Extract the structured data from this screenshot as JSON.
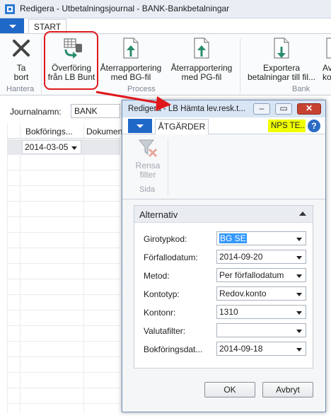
{
  "main": {
    "title": "Redigera - Utbetalningsjournal - BANK-Bankbetalningar",
    "tab": "START",
    "ribbon": {
      "ta_bort": "Ta\nbort",
      "overforing": "Överföring\nfrån LB Bunt",
      "ater_bg": "Återrapportering\nmed BG-fil",
      "ater_pg": "Återrapportering\nmed PG-fil",
      "exportera": "Exportera\nbetalningar till fil...",
      "partial_right": "Av\nko",
      "groups": {
        "hantera": "Hantera",
        "process": "Process",
        "bank": "Bank"
      }
    },
    "journal": {
      "label": "Journalnamn:",
      "value": "BANK"
    },
    "grid": {
      "col1": "Bokförings...",
      "col2": "Dokumen",
      "date_value": "2014-03-05"
    }
  },
  "dialog": {
    "title": "Redigera - LB Hämta lev.resk.t...",
    "tab": "ÅTGÄRDER",
    "badge": "NPS TE...",
    "help": "?",
    "rensa": "Rensa\nfilter",
    "sida": "Sida",
    "panel_title": "Alternativ",
    "fields": [
      {
        "label": "Girotypkod:",
        "value": "BG SE"
      },
      {
        "label": "Förfallodatum:",
        "value": "2014-09-20"
      },
      {
        "label": "Metod:",
        "value": "Per förfallodatum"
      },
      {
        "label": "Kontotyp:",
        "value": "Redov.konto"
      },
      {
        "label": "Kontonr:",
        "value": "1310"
      },
      {
        "label": "Valutafilter:",
        "value": ""
      },
      {
        "label": "Bokföringsdat...",
        "value": "2014-09-18"
      }
    ],
    "ok": "OK",
    "cancel": "Avbryt"
  },
  "colors": {
    "accent": "#1f68c7",
    "highlight": "#e0171b",
    "badge": "#f0ff00"
  }
}
